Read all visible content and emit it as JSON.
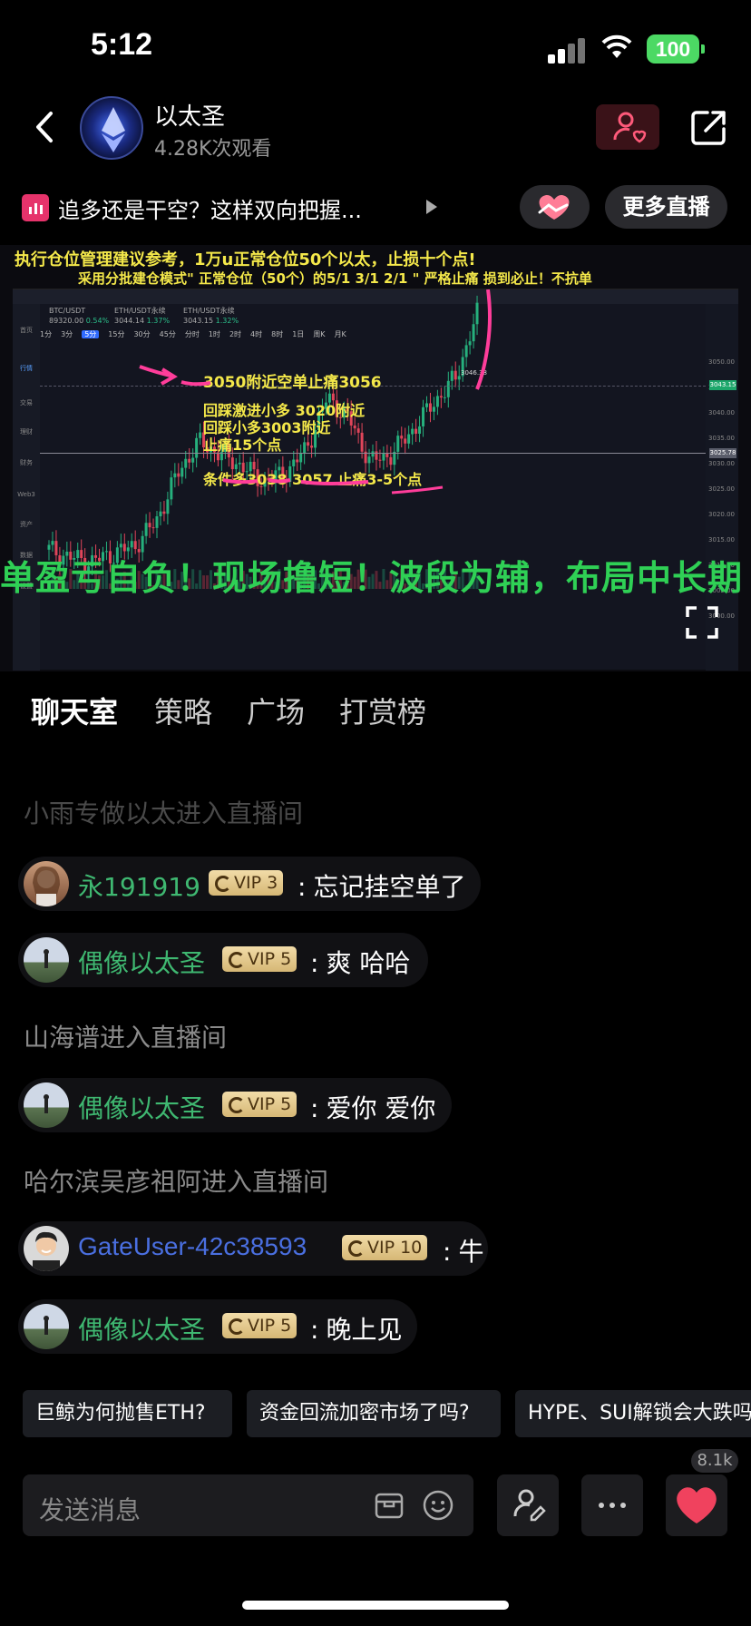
{
  "status_bar": {
    "time": "5:12",
    "battery": "100"
  },
  "header": {
    "host_name": "以太圣",
    "views": "4.28K次观看",
    "stream_title": "追多还是干空？这样双向把握...",
    "more_live_label": "更多直播"
  },
  "video": {
    "banner_line1": "执行仓位管理建议参考，1万u正常仓位50个以太，止损十个点!",
    "banner_line2": "采用分批建仓模式\" 正常仓位（50个）的5/1  3/1  2/1 \" 严格止痛 损到必止！不抗单",
    "tickers": [
      {
        "name": "BTC/USDT",
        "value": "89320.00",
        "pct": "0.54%"
      },
      {
        "name": "ETH/USDT永续",
        "value": "3044.14",
        "pct": "1.37%"
      },
      {
        "name": "ETH/USDT永续",
        "value": "3043.15",
        "pct": "1.32%"
      }
    ],
    "intervals": [
      "1分",
      "3分",
      "5分",
      "15分",
      "30分",
      "45分",
      "分时",
      "1时",
      "2时",
      "4时",
      "8时",
      "1日",
      "周K",
      "月K"
    ],
    "active_interval": "5分",
    "side_nav": [
      "首页",
      "行情",
      "交易",
      "理财",
      "财务",
      "Web3",
      "资产",
      "数据",
      "设置"
    ],
    "price_ticks": [
      "3050.00",
      "3045.00",
      "3040.00",
      "3035.00",
      "3030.00",
      "3025.00",
      "3020.00",
      "3015.00",
      "3010.00",
      "3005.00",
      "3000.00"
    ],
    "price_tag_current": "3043.15",
    "price_tag_line": "3025.78",
    "high_label": "3046.38",
    "annotation1": "3050附近空单止痛3056",
    "annotation2_lines": [
      "回踩激进小多 3020附近",
      "回踩小多3003附近",
      "止痛15个点"
    ],
    "annotation3": "条件多3038 3057 止痛3-5个点",
    "marquee": "单盈亏自负！现场撸短！波段为辅，布局中长期"
  },
  "tabs": [
    "聊天室",
    "策略",
    "广场",
    "打赏榜"
  ],
  "chat": [
    {
      "type": "system",
      "text": "小雨专做以太进入直播间",
      "faded": true
    },
    {
      "type": "msg",
      "user": "永191919",
      "user_color": "#3fb871",
      "vip": "VIP 3",
      "text": "忘记挂空单了",
      "avatar": "avatar-woman"
    },
    {
      "type": "msg",
      "user": "偶像以太圣",
      "user_color": "#3fb871",
      "vip": "VIP 5",
      "text": "爽 哈哈",
      "avatar": "avatar-landscape"
    },
    {
      "type": "system",
      "text": "山海谱进入直播间"
    },
    {
      "type": "msg",
      "user": "偶像以太圣",
      "user_color": "#3fb871",
      "vip": "VIP 5",
      "text": "爱你 爱你",
      "avatar": "avatar-landscape"
    },
    {
      "type": "system",
      "text": "哈尔滨吴彦祖阿进入直播间"
    },
    {
      "type": "msg",
      "user": "GateUser-42c38593",
      "user_color": "#4a6fe0",
      "vip": "VIP 10",
      "text": "牛",
      "avatar": "avatar-man"
    },
    {
      "type": "msg",
      "user": "偶像以太圣",
      "user_color": "#3fb871",
      "vip": "VIP 5",
      "text": "晚上见",
      "avatar": "avatar-landscape"
    }
  ],
  "topic_chips": [
    "巨鲸为何抛售ETH?",
    "资金回流加密市场了吗?",
    "HYPE、SUI解锁会大跌吗"
  ],
  "bottom_bar": {
    "placeholder": "发送消息",
    "like_count": "8.1k"
  },
  "colors": {
    "accent_pink": "#e6336b",
    "green_text": "#3fb871",
    "blue_text": "#4a6fe0",
    "vip_gold": "#e3c98a",
    "annotation_yellow": "#f4e84a"
  },
  "icons": [
    "back-arrow-icon",
    "follow-user-heart-icon",
    "share-icon",
    "heart-hands-icon",
    "fullscreen-icon",
    "wallet-icon",
    "emoji-icon",
    "user-edit-icon",
    "more-dots-icon",
    "heart-like-icon"
  ],
  "chart_data": {
    "type": "line",
    "title": "",
    "xlabel": "",
    "ylabel": "",
    "ylim": [
      3000,
      3050
    ],
    "y": [
      3003,
      3001,
      3000,
      3002,
      3004,
      3010,
      3022,
      3030,
      3027,
      3024,
      3020,
      3022,
      3028,
      3041,
      3036,
      3025,
      3027,
      3033,
      3040,
      3046,
      3062
    ]
  }
}
